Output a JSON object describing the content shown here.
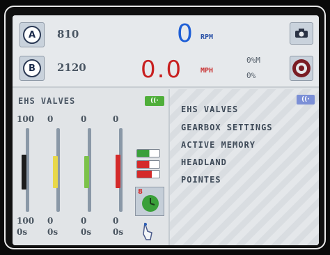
{
  "header": {
    "button_a_letter": "A",
    "button_a_value": "810",
    "button_b_letter": "B",
    "button_b_value": "2120",
    "rpm_value": "0",
    "rpm_unit": "RPM",
    "speed_value": "0.0",
    "speed_unit": "MPH",
    "right_top": "0%M",
    "right_bottom": "0%"
  },
  "ehs_panel": {
    "title": "EHS VALVES",
    "badge": "((·",
    "valves": [
      {
        "top": "100",
        "bottom": "100",
        "bottom_unit": "0s",
        "color": "#1c1c1c",
        "level": 1.0
      },
      {
        "top": "0",
        "bottom": "0",
        "bottom_unit": "0s",
        "color": "#e8d84a",
        "level": 0.0
      },
      {
        "top": "0",
        "bottom": "0",
        "bottom_unit": "0s",
        "color": "#7cc24a",
        "level": 0.0
      },
      {
        "top": "0",
        "bottom": "0",
        "bottom_unit": "0s",
        "color": "#d42a2a",
        "level": 0.0
      }
    ],
    "indicator": "8"
  },
  "menu": {
    "badge": "((·",
    "items": [
      "EHS VALVES",
      "GEARBOX SETTINGS",
      "ACTIVE MEMORY",
      "HEADLAND",
      "POINTES"
    ]
  },
  "colors": {
    "rpm": "#1f5fd6",
    "speed": "#c82020",
    "accent_green": "#4fae3a"
  }
}
